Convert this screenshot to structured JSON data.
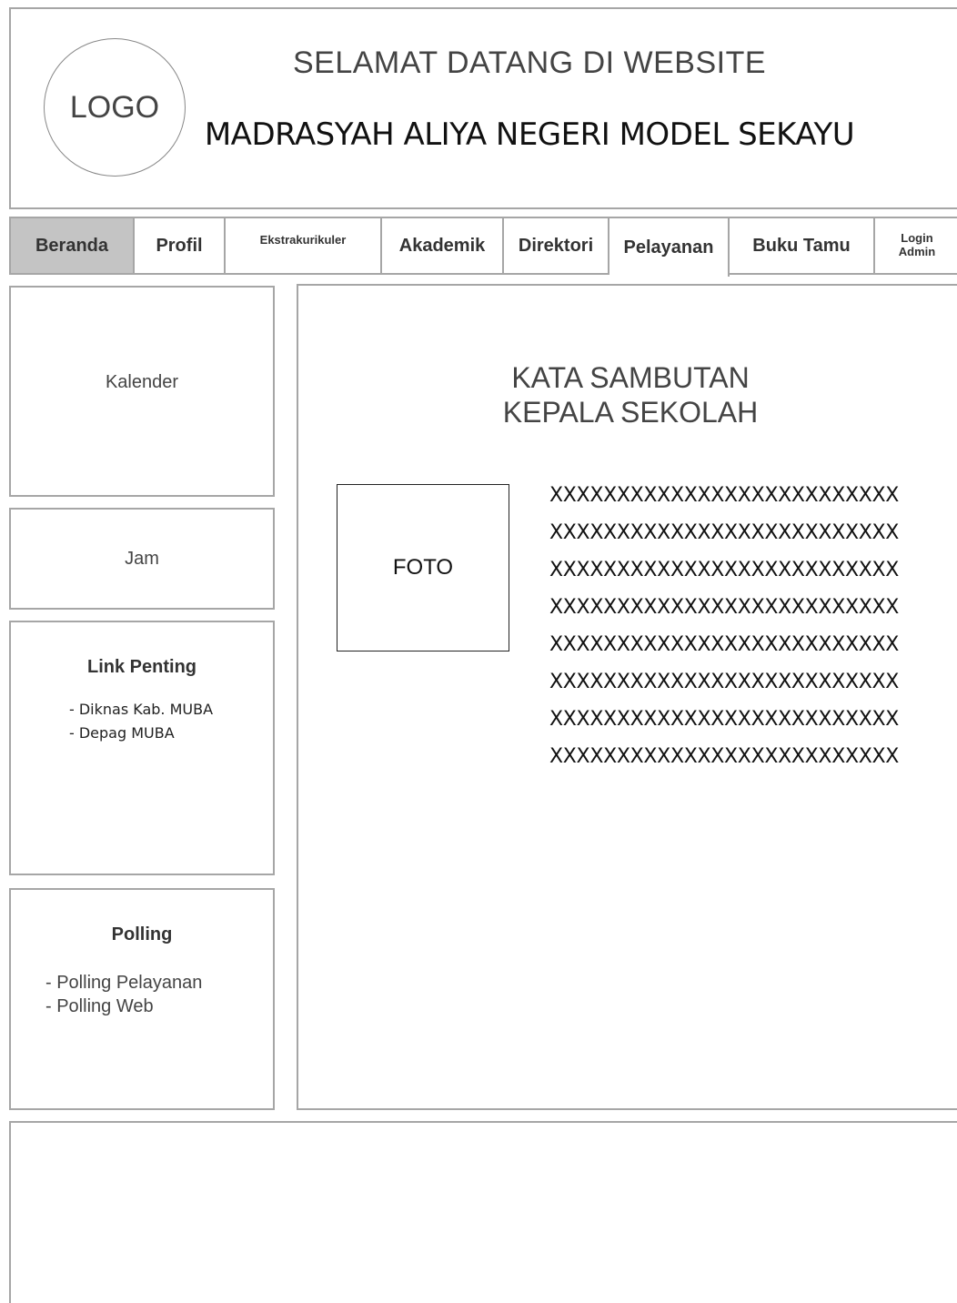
{
  "header": {
    "logo_text": "LOGO",
    "welcome": "SELAMAT DATANG DI WEBSITE",
    "school_name": "MADRASYAH ALIYA NEGERI MODEL SEKAYU"
  },
  "nav": {
    "beranda": "Beranda",
    "profil": "Profil",
    "ekstrakurikuler": "Ekstrakurikuler",
    "akademik": "Akademik",
    "direktori": "Direktori",
    "pelayanan": "Pelayanan",
    "buku_tamu": "Buku Tamu",
    "login_admin_line1": "Login",
    "login_admin_line2": "Admin"
  },
  "sidebar": {
    "kalender": "Kalender",
    "jam": "Jam",
    "links_title": "Link Penting",
    "links": [
      "-  Diknas  Kab. MUBA",
      "-  Depag MUBA"
    ],
    "polling_title": "Polling",
    "polls": [
      "- Polling Pelayanan",
      "- Polling Web"
    ]
  },
  "main": {
    "title_line1": "KATA SAMBUTAN",
    "title_line2": "KEPALA SEKOLAH",
    "foto_label": "FOTO",
    "text_lines": [
      "XXXXXXXXXXXXXXXXXXXXXXXXXX",
      "XXXXXXXXXXXXXXXXXXXXXXXXXX",
      "XXXXXXXXXXXXXXXXXXXXXXXXXX",
      "XXXXXXXXXXXXXXXXXXXXXXXXXX",
      "XXXXXXXXXXXXXXXXXXXXXXXXXX",
      "XXXXXXXXXXXXXXXXXXXXXXXXXX",
      "XXXXXXXXXXXXXXXXXXXXXXXXXX",
      "XXXXXXXXXXXXXXXXXXXXXXXXXX"
    ]
  },
  "colors": {
    "border": "#a6a6a6",
    "active_nav": "#c4c4c4"
  }
}
